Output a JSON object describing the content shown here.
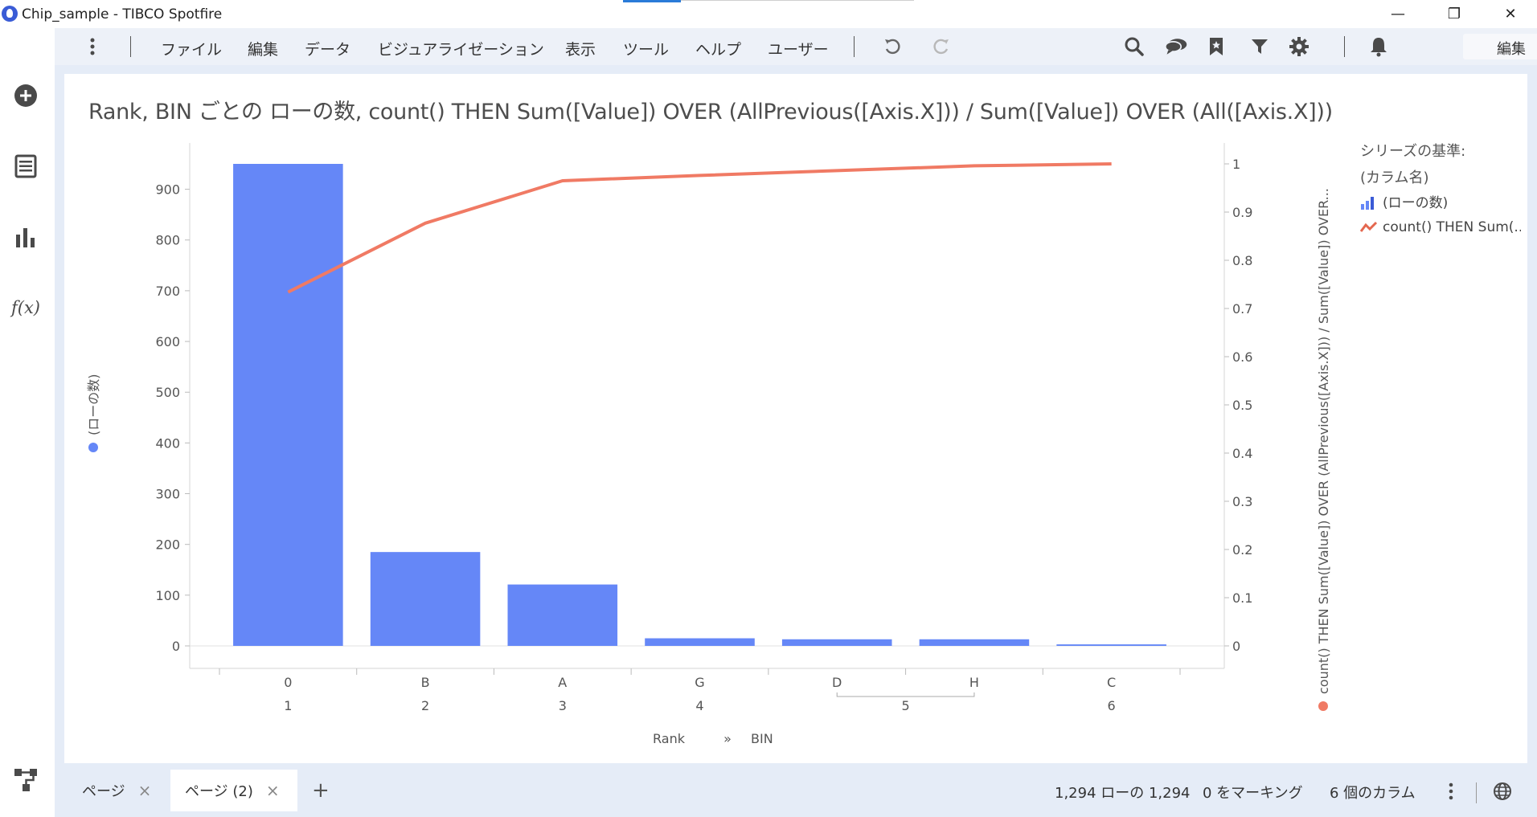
{
  "window": {
    "title": "Chip_sample - TIBCO Spotfire",
    "minimize_glyph": "—",
    "restore_glyph": "❐",
    "close_glyph": "✕"
  },
  "menu": {
    "items": [
      "ファイル",
      "編集",
      "データ",
      "ビジュアライゼーション",
      "表示",
      "ツール",
      "ヘルプ",
      "ユーザー"
    ],
    "edit_dropdown": "編集"
  },
  "sidebar": {
    "icons": [
      "add-icon",
      "data-table-icon",
      "bar-chart-icon",
      "formula-icon",
      "data-flow-icon"
    ],
    "formula_label": "f(x)"
  },
  "toolbar_icons": [
    "undo-icon",
    "redo-icon",
    "search-icon",
    "comments-icon",
    "bookmark-icon",
    "filter-icon",
    "settings-icon",
    "notifications-icon"
  ],
  "colors": {
    "bar": "#6587f7",
    "line": "#f07a64",
    "frame": "#e5ecf7"
  },
  "chart_data": {
    "type": "bar",
    "title": "Rank, BIN ごとの ローの数, count() THEN Sum([Value]) OVER (AllPrevious([Axis.X])) / Sum([Value]) OVER (All([Axis.X]))",
    "categories": [
      "0",
      "B",
      "A",
      "G",
      "D",
      "H",
      "C"
    ],
    "category_groups": [
      "1",
      "2",
      "3",
      "4",
      "5",
      "5",
      "6"
    ],
    "group_labels": [
      {
        "label": "1",
        "members": [
          "0"
        ]
      },
      {
        "label": "2",
        "members": [
          "B"
        ]
      },
      {
        "label": "3",
        "members": [
          "A"
        ]
      },
      {
        "label": "4",
        "members": [
          "G"
        ]
      },
      {
        "label": "5",
        "members": [
          "D",
          "H"
        ]
      },
      {
        "label": "6",
        "members": [
          "C"
        ]
      }
    ],
    "series": [
      {
        "name": "(ローの数)",
        "type": "bar",
        "axis": "left",
        "values": [
          950,
          185,
          121,
          15,
          13,
          13,
          3
        ]
      },
      {
        "name": "count() THEN Sum(...",
        "type": "line",
        "axis": "right",
        "values": [
          0.734,
          0.877,
          0.965,
          0.976,
          0.986,
          0.996,
          1.0
        ]
      }
    ],
    "ylim": [
      0,
      1000
    ],
    "yticks": [
      0,
      100,
      200,
      300,
      400,
      500,
      600,
      700,
      800,
      900
    ],
    "y2lim": [
      0,
      1.05
    ],
    "y2ticks": [
      0,
      0.1,
      0.2,
      0.3,
      0.4,
      0.5,
      0.6,
      0.7,
      0.8,
      0.9,
      1
    ],
    "ylabel": "(ローの数)",
    "y2label": "count() THEN Sum([Value]) OVER (AllPrevious([Axis.X])) / Sum([Value]) OVER...",
    "xlabel_parts": [
      "Rank",
      "»",
      "BIN"
    ],
    "legend": {
      "title_line1": "シリーズの基準:",
      "title_line2": "(カラム名)",
      "entries": [
        "(ローの数)",
        "count() THEN Sum(..."
      ],
      "placement": "right"
    },
    "grid": false
  },
  "tabs": {
    "pages": [
      "ページ",
      "ページ (2)"
    ],
    "active_index": 1,
    "add_label": "+",
    "close_glyph": "×"
  },
  "status": {
    "rows": "1,294 ローの 1,294",
    "marking": "0 をマーキング",
    "columns": "6 個のカラム"
  }
}
